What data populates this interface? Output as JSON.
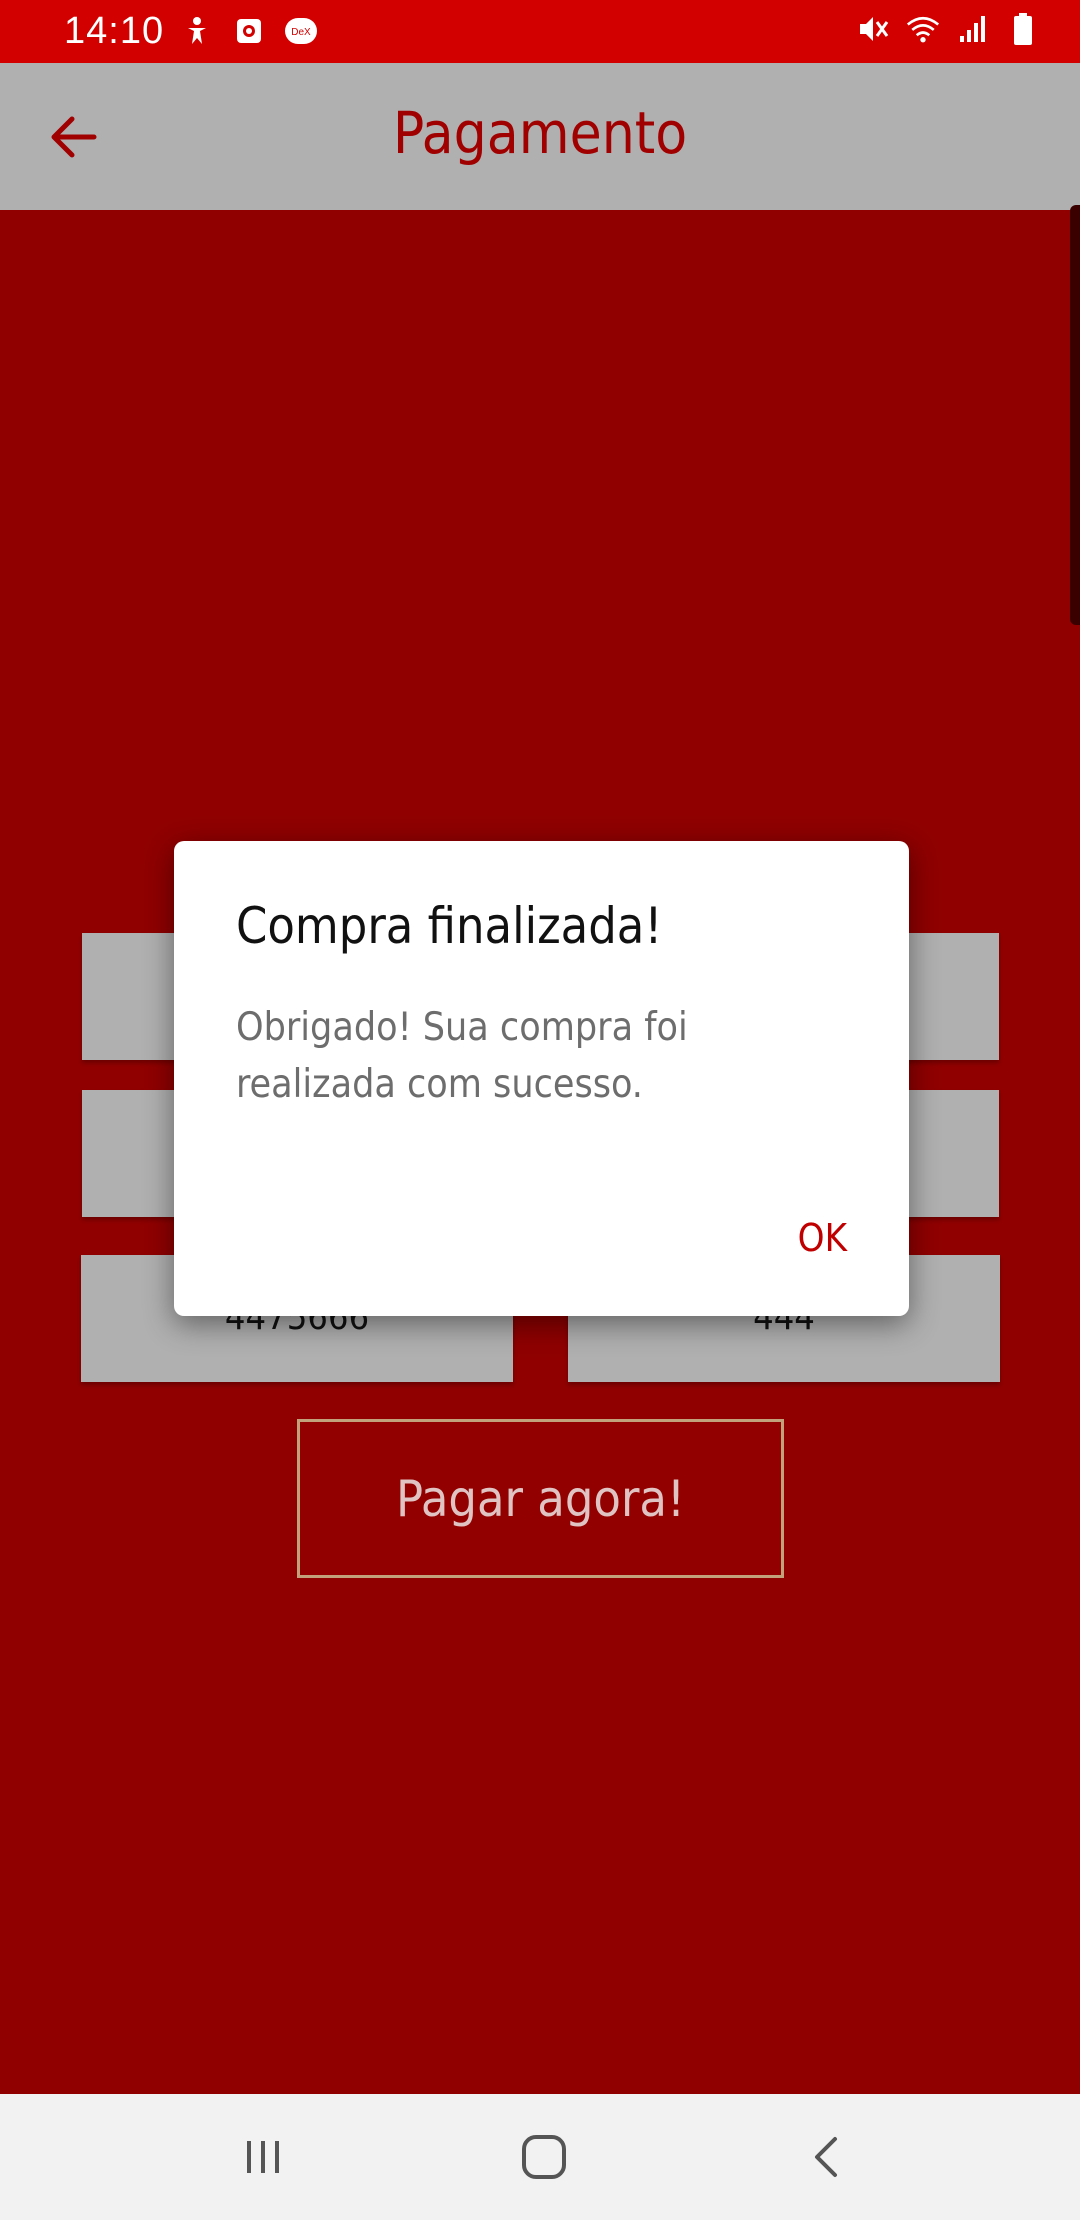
{
  "status_bar": {
    "time": "14:10",
    "left_icons": [
      "accessibility-icon",
      "screen-recorder-icon",
      "dex-icon"
    ],
    "dex_label": "DeX",
    "right_icons": [
      "mute-icon",
      "wifi-icon",
      "signal-icon",
      "battery-icon"
    ]
  },
  "app_bar": {
    "title": "Pagamento",
    "back_icon": "arrow-left-icon"
  },
  "form": {
    "card_number_value": "4475666",
    "cvv_value": "444"
  },
  "pay_button": {
    "label": "Pagar agora!"
  },
  "dialog": {
    "title": "Compra finalizada!",
    "message": "Obrigado! Sua compra foi realizada com sucesso.",
    "ok_label": "OK"
  },
  "nav_bar": {
    "buttons": [
      "recent-apps-icon",
      "home-icon",
      "back-icon"
    ]
  },
  "colors": {
    "status_bar": "#d30000",
    "app_bar": "#b0b0b0",
    "background": "#900000",
    "accent": "#c00000"
  }
}
